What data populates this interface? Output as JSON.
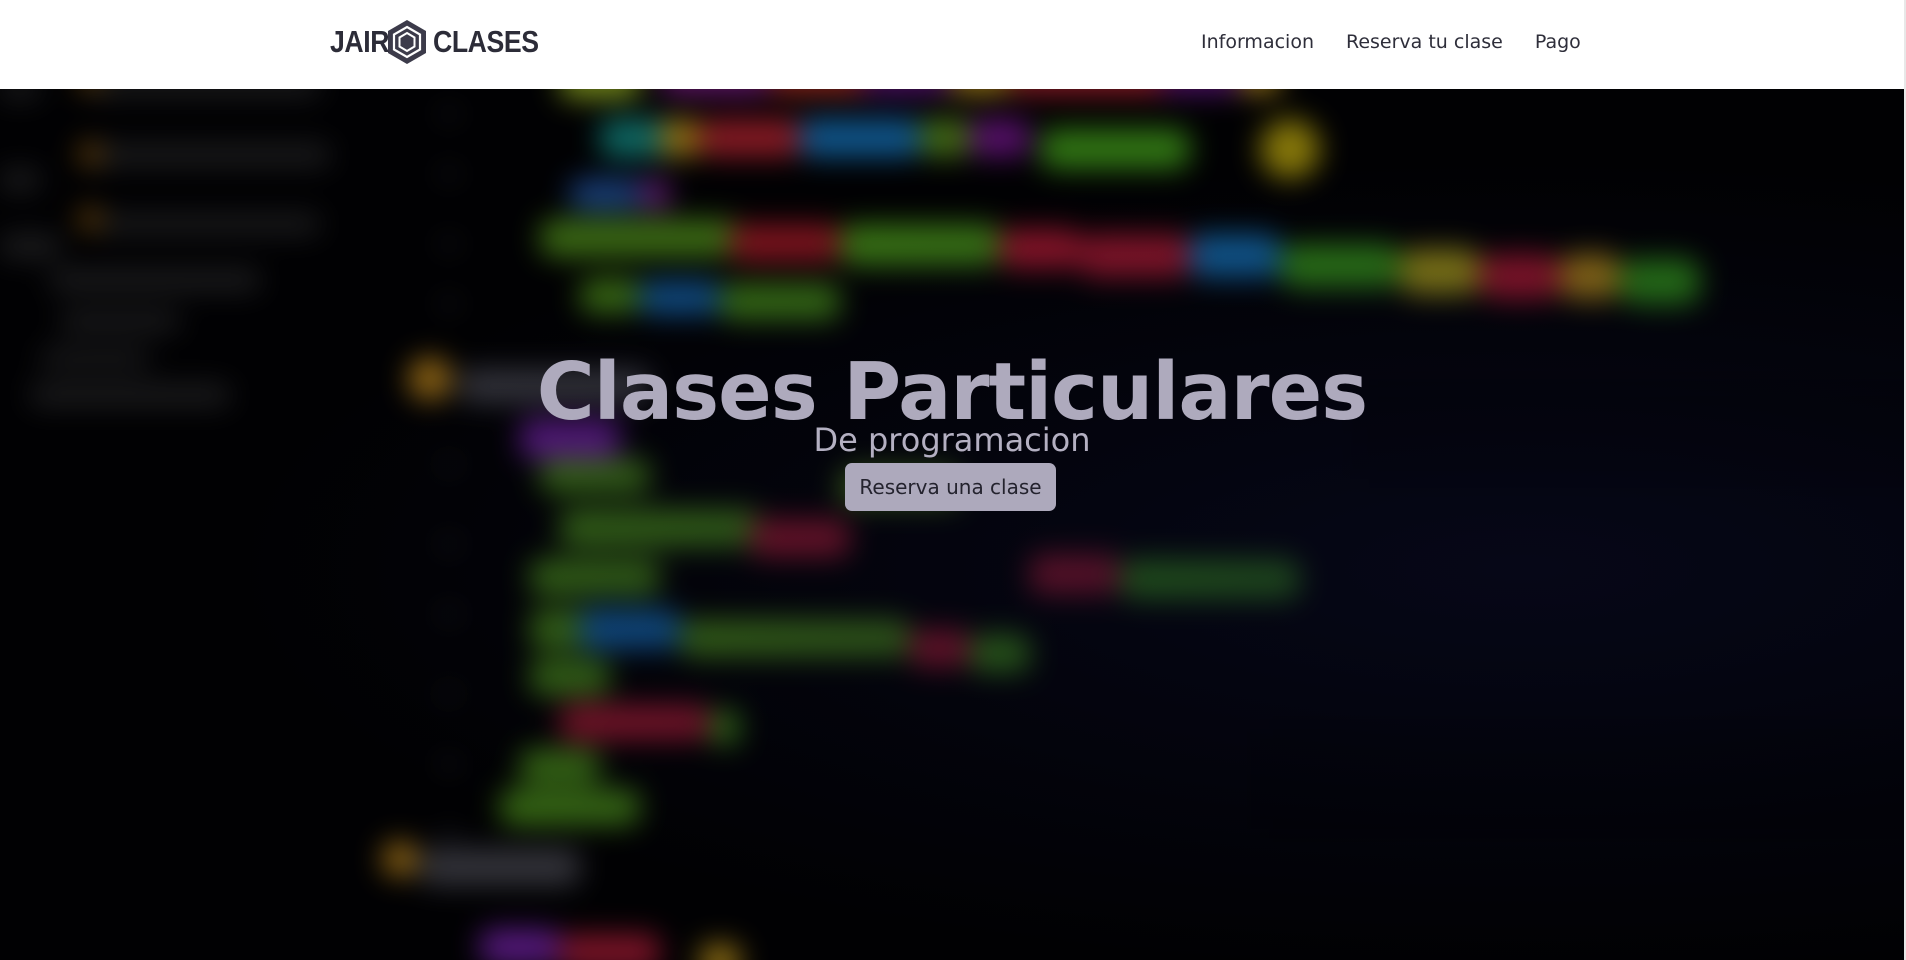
{
  "navbar": {
    "brand_left": "JAIR",
    "brand_right": "CLASES",
    "logo_icon": "hexagon-logo-icon",
    "links": [
      {
        "label": "Informacion"
      },
      {
        "label": "Reserva tu clase"
      },
      {
        "label": "Pago"
      }
    ]
  },
  "hero": {
    "title": "Clases Particulares",
    "subtitle": "De programacion",
    "cta_label": "Reserva una clase",
    "background": "blurred-code-editor-image"
  },
  "colors": {
    "brand_text": "#2c2c38",
    "hero_text": "#aeaabd",
    "button_bg": "#ada9bc",
    "hero_bg": "#03030a"
  }
}
